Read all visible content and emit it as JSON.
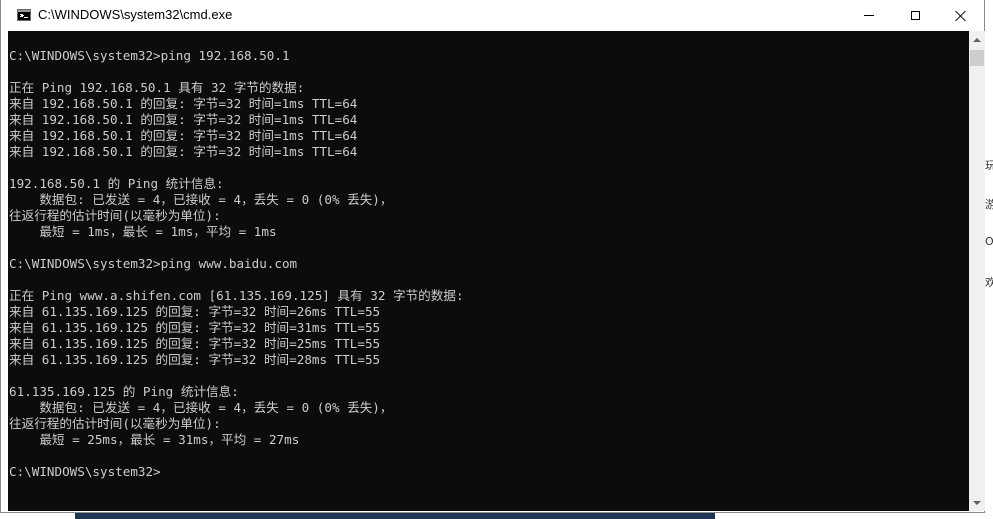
{
  "window": {
    "title": "C:\\WINDOWS\\system32\\cmd.exe",
    "icon": "console-app-icon",
    "controls": [
      "minimize-icon",
      "maximize-icon",
      "close-icon"
    ]
  },
  "console": {
    "background_color": "#0c0c0c",
    "text_color": "#cccccc",
    "lines": [
      "C:\\WINDOWS\\system32>ping 192.168.50.1",
      "",
      "正在 Ping 192.168.50.1 具有 32 字节的数据:",
      "来自 192.168.50.1 的回复: 字节=32 时间=1ms TTL=64",
      "来自 192.168.50.1 的回复: 字节=32 时间=1ms TTL=64",
      "来自 192.168.50.1 的回复: 字节=32 时间=1ms TTL=64",
      "来自 192.168.50.1 的回复: 字节=32 时间=1ms TTL=64",
      "",
      "192.168.50.1 的 Ping 统计信息:",
      "    数据包: 已发送 = 4，已接收 = 4，丢失 = 0 (0% 丢失)，",
      "往返行程的估计时间(以毫秒为单位):",
      "    最短 = 1ms，最长 = 1ms，平均 = 1ms",
      "",
      "C:\\WINDOWS\\system32>ping www.baidu.com",
      "",
      "正在 Ping www.a.shifen.com [61.135.169.125] 具有 32 字节的数据:",
      "来自 61.135.169.125 的回复: 字节=32 时间=26ms TTL=55",
      "来自 61.135.169.125 的回复: 字节=32 时间=31ms TTL=55",
      "来自 61.135.169.125 的回复: 字节=32 时间=25ms TTL=55",
      "来自 61.135.169.125 的回复: 字节=32 时间=28ms TTL=55",
      "",
      "61.135.169.125 的 Ping 统计信息:",
      "    数据包: 已发送 = 4，已接收 = 4，丢失 = 0 (0% 丢失)，",
      "往返行程的估计时间(以毫秒为单位):",
      "    最短 = 25ms，最长 = 31ms，平均 = 27ms",
      "",
      "C:\\WINDOWS\\system32>"
    ]
  },
  "background": {
    "edge_glyphs": [
      "玩",
      "游",
      "O",
      "欢"
    ]
  }
}
